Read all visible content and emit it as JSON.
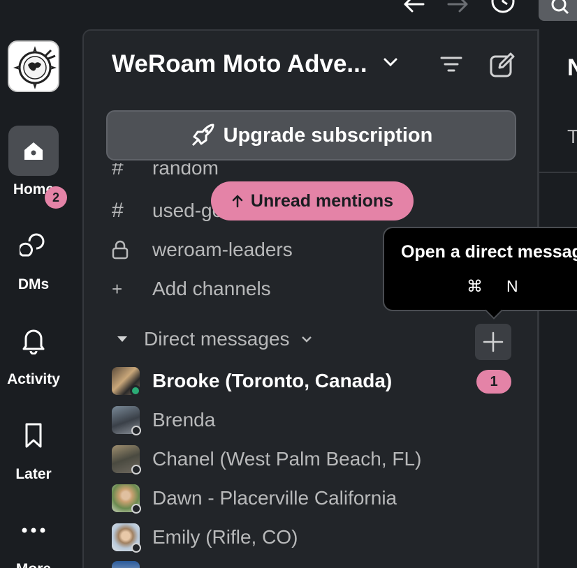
{
  "workspace": {
    "name": "WeRoam Moto Adve..."
  },
  "rail": {
    "items": [
      {
        "label": "Home",
        "icon": "home-icon"
      },
      {
        "label": "DMs",
        "icon": "dms-icon",
        "badge": "2"
      },
      {
        "label": "Activity",
        "icon": "bell-icon"
      },
      {
        "label": "Later",
        "icon": "bookmark-icon"
      },
      {
        "label": "More",
        "icon": "ellipsis-icon"
      }
    ]
  },
  "upgrade": {
    "label": "Upgrade subscription"
  },
  "unread_pill": {
    "label": "Unread mentions"
  },
  "channels": [
    {
      "name": "random",
      "icon": "#"
    },
    {
      "name": "used-ge",
      "icon": "#"
    },
    {
      "name": "weroam-leaders",
      "icon": "lock"
    }
  ],
  "add_channels": {
    "label": "Add channels"
  },
  "dm_section": {
    "label": "Direct messages"
  },
  "tooltip": {
    "title": "Open a direct message",
    "key1": "⌘",
    "key2": "N"
  },
  "dm_unread_count": "1",
  "direct_messages": [
    {
      "name": "Brooke (Toronto, Canada)",
      "status": "online",
      "unread": true
    },
    {
      "name": "Brenda",
      "status": "away",
      "unread": false
    },
    {
      "name": "Chanel (West Palm Beach, FL)",
      "status": "away",
      "unread": false
    },
    {
      "name": "Dawn - Placerville California",
      "status": "away",
      "unread": false
    },
    {
      "name": "Emily (Rifle, CO)",
      "status": "away",
      "unread": false
    }
  ],
  "right_pane": {
    "title": "N",
    "subtitle": "T"
  },
  "colors": {
    "accent_pink": "#e483a7",
    "online_green": "#2bac76",
    "panel_bg": "#222529",
    "rail_bg": "#1a1d21"
  }
}
